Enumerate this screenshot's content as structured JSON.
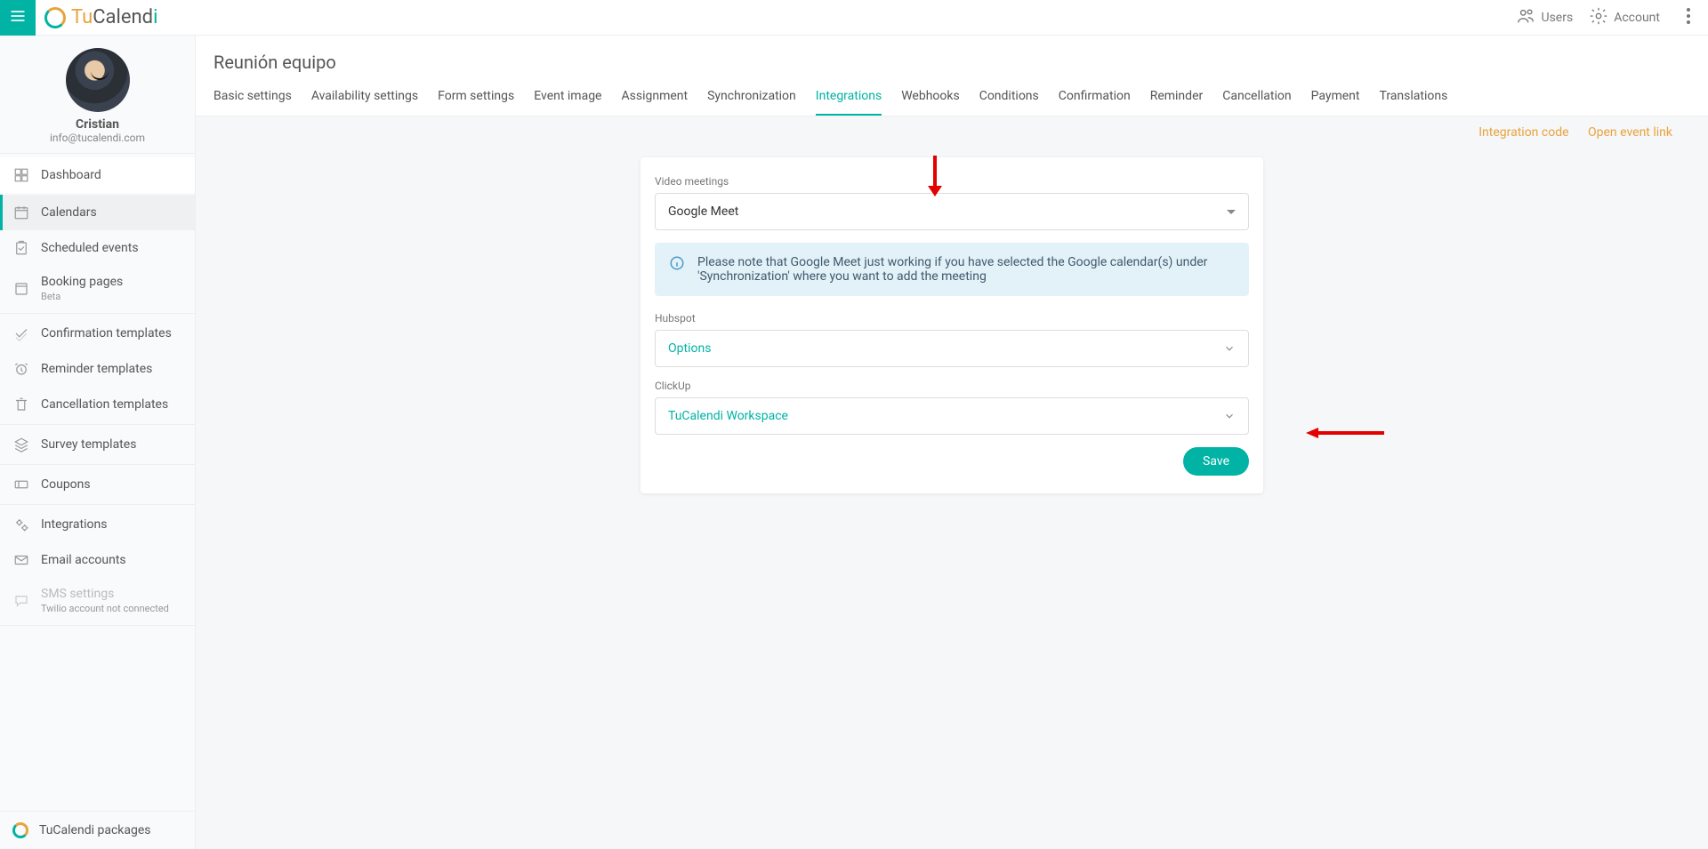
{
  "brand": {
    "part1": "Tu",
    "part2": "Calend",
    "part3": "i"
  },
  "topbar": {
    "users": "Users",
    "account": "Account"
  },
  "profile": {
    "name": "Cristian",
    "email": "info@tucalendi.com"
  },
  "sidebar": {
    "dashboard": "Dashboard",
    "calendars": "Calendars",
    "scheduled_events": "Scheduled events",
    "booking_pages": "Booking pages",
    "booking_pages_beta": "Beta",
    "confirmation_templates": "Confirmation templates",
    "reminder_templates": "Reminder templates",
    "cancellation_templates": "Cancellation templates",
    "survey_templates": "Survey templates",
    "coupons": "Coupons",
    "integrations": "Integrations",
    "email_accounts": "Email accounts",
    "sms_settings": "SMS settings",
    "sms_settings_sub": "Twilio account not connected",
    "packages": "TuCalendi packages"
  },
  "page": {
    "title": "Reunión equipo"
  },
  "tabs": {
    "basic": "Basic settings",
    "availability": "Availability settings",
    "form": "Form settings",
    "event_image": "Event image",
    "assignment": "Assignment",
    "synchronization": "Synchronization",
    "integrations": "Integrations",
    "webhooks": "Webhooks",
    "conditions": "Conditions",
    "confirmation": "Confirmation",
    "reminder": "Reminder",
    "cancellation": "Cancellation",
    "payment": "Payment",
    "translations": "Translations"
  },
  "links": {
    "integration_code": "Integration code",
    "open_event": "Open event link"
  },
  "form": {
    "video_label": "Video meetings",
    "video_value": "Google Meet",
    "info_text": "Please note that Google Meet just working if you have selected the Google calendar(s) under 'Synchronization' where you want to add the meeting",
    "hubspot_label": "Hubspot",
    "hubspot_value": "Options",
    "clickup_label": "ClickUp",
    "clickup_value": "TuCalendi Workspace",
    "save": "Save"
  }
}
